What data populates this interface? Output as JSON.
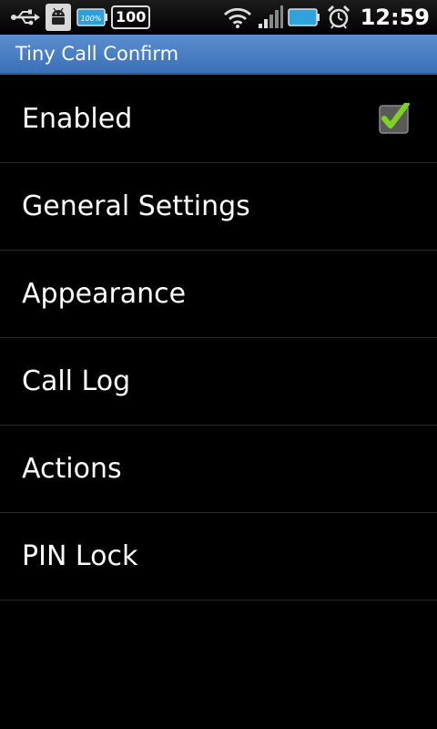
{
  "status_bar": {
    "icons": [
      "usb-icon",
      "android-debug-icon",
      "battery-100-icon",
      "number-100-icon",
      "wifi-icon",
      "signal-icon",
      "battery-icon",
      "alarm-icon"
    ],
    "small_battery_text": "100%",
    "notification_count": "100",
    "time": "12:59"
  },
  "title_bar": {
    "title": "Tiny Call Confirm"
  },
  "settings": {
    "items": [
      {
        "label": "Enabled",
        "checked": true
      },
      {
        "label": "General Settings"
      },
      {
        "label": "Appearance"
      },
      {
        "label": "Call Log"
      },
      {
        "label": "Actions"
      },
      {
        "label": "PIN Lock"
      }
    ]
  },
  "colors": {
    "title_bar": "#4a80c4",
    "background": "#000000",
    "checkmark": "#7ed321"
  }
}
